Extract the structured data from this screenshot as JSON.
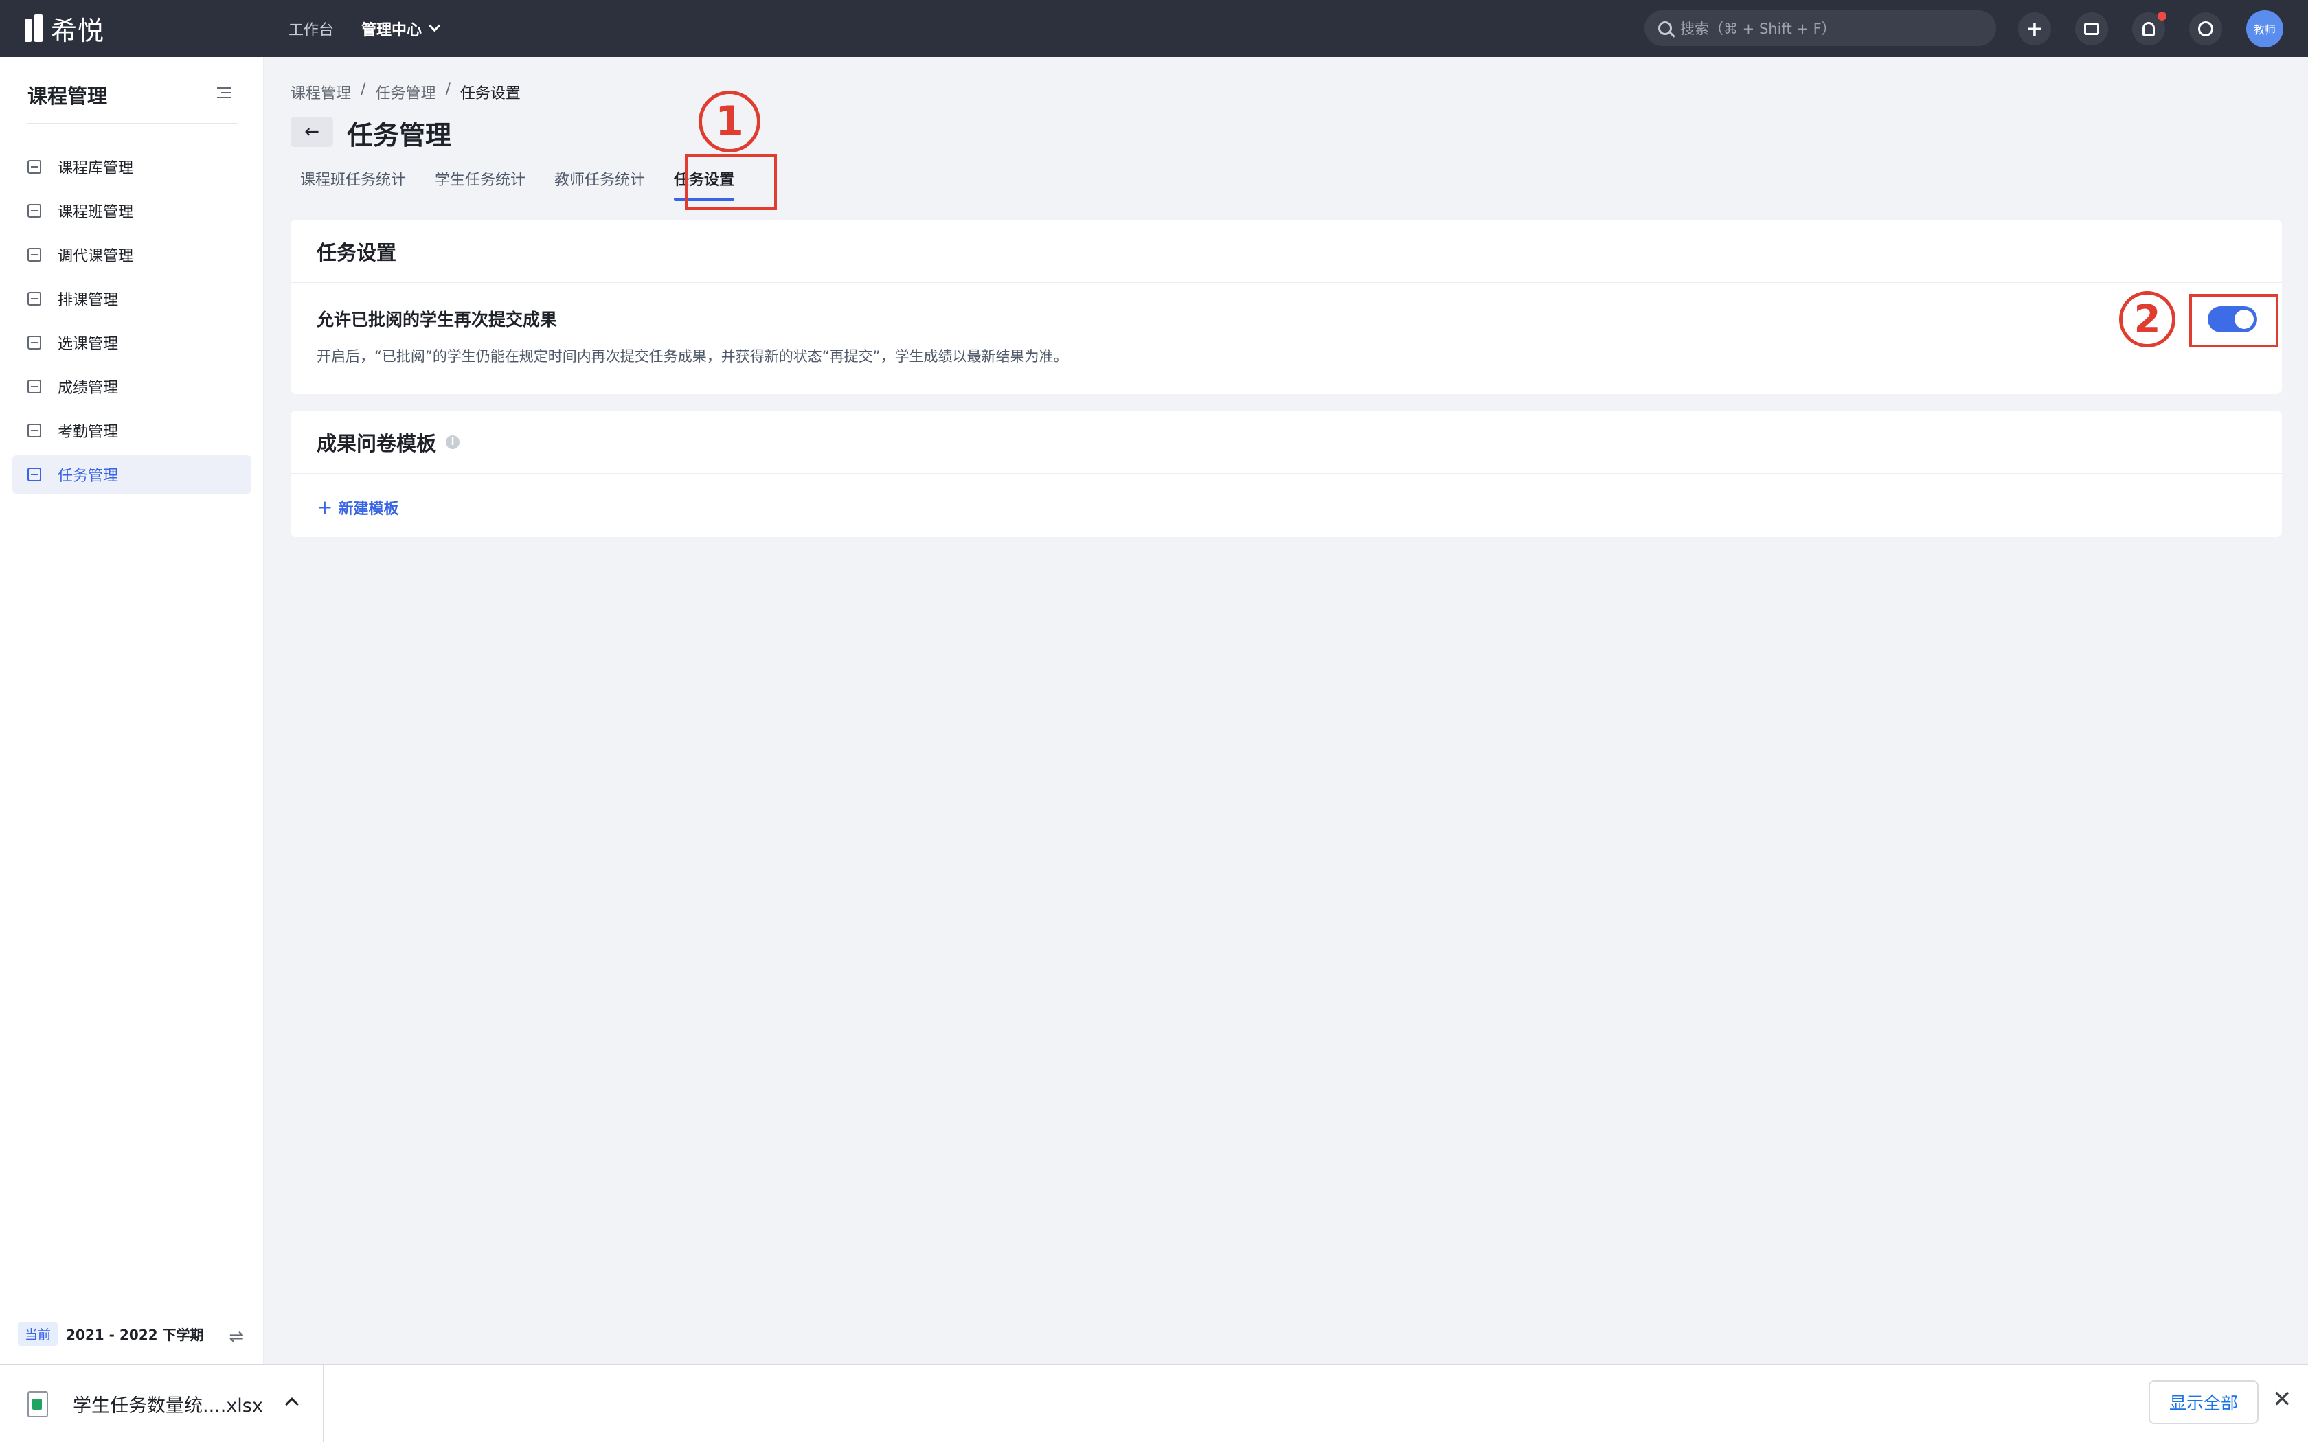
{
  "app": {
    "logo_text": "希悦"
  },
  "topbar": {
    "nav_workbench": "工作台",
    "nav_admin": "管理中心",
    "search_placeholder": "搜索（⌘ + Shift + F）",
    "plus_label": "+",
    "avatar_text": "教师"
  },
  "sidebar": {
    "title": "课程管理",
    "items": [
      {
        "label": "课程库管理",
        "icon": "list-icon"
      },
      {
        "label": "课程班管理",
        "icon": "class-icon"
      },
      {
        "label": "调代课管理",
        "icon": "swap-icon"
      },
      {
        "label": "排课管理",
        "icon": "schedule-icon"
      },
      {
        "label": "选课管理",
        "icon": "checkbox-icon"
      },
      {
        "label": "成绩管理",
        "icon": "grade-icon"
      },
      {
        "label": "考勤管理",
        "icon": "calendar-icon"
      },
      {
        "label": "任务管理",
        "icon": "task-list-icon",
        "active": true
      }
    ],
    "footer": {
      "badge": "当前",
      "term": "2021 - 2022 下学期",
      "switch_icon": "⇌"
    }
  },
  "breadcrumb": [
    "课程管理",
    "任务管理",
    "任务设置"
  ],
  "breadcrumb_sep": "/",
  "page": {
    "title": "任务管理",
    "back_icon": "←",
    "tabs": [
      {
        "label": "课程班任务统计"
      },
      {
        "label": "学生任务统计"
      },
      {
        "label": "教师任务统计"
      },
      {
        "label": "任务设置",
        "active": true
      }
    ]
  },
  "annotations": {
    "n1": "1",
    "n2": "2",
    "color": "#e03c2f"
  },
  "task_settings": {
    "heading": "任务设置",
    "setting_title": "允许已批阅的学生再次提交成果",
    "setting_desc": "开启后，“已批阅”的学生仍能在规定时间内再次提交任务成果，并获得新的状态“再提交”，学生成绩以最新结果为准。",
    "toggle_on": true
  },
  "template_section": {
    "heading": "成果问卷模板",
    "info_icon": "i",
    "new_button": "新建模板",
    "new_button_icon": "+"
  },
  "download_bar": {
    "file_name": "学生任务数量统....xlsx",
    "show_all": "显示全部",
    "close_icon": "✕"
  },
  "colors": {
    "accent": "#3765e6",
    "topbar_bg": "#2c313d",
    "toggle_on": "#3d6ce6"
  }
}
